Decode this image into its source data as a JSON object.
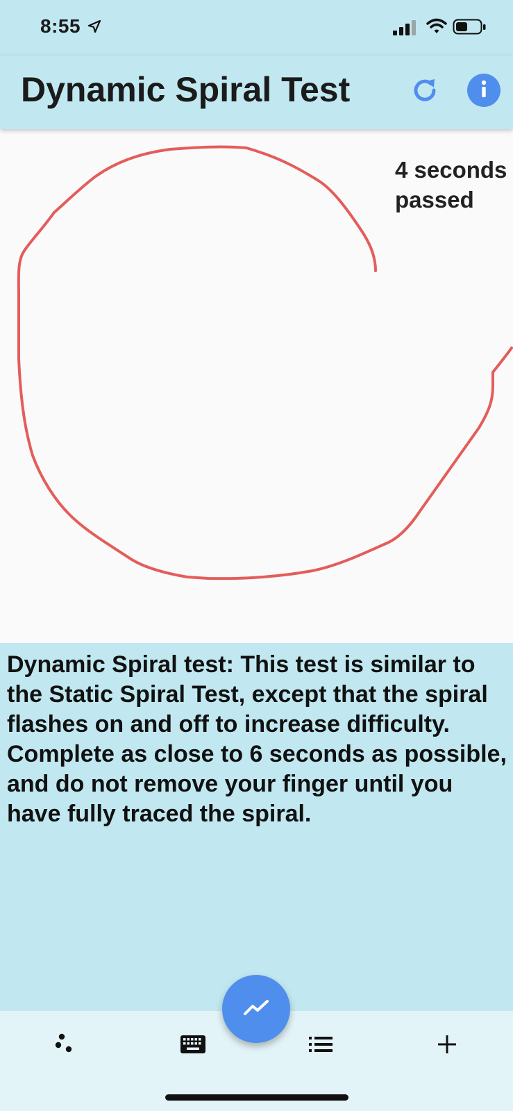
{
  "status_bar": {
    "time": "8:55"
  },
  "app_bar": {
    "title": "Dynamic Spiral Test",
    "refresh_icon": "refresh-icon",
    "info_icon": "info-icon"
  },
  "canvas": {
    "timer_text": "4 seconds passed",
    "stroke_color": "#e35d5b"
  },
  "instructions": {
    "text": "Dynamic Spiral test: This test is similar to the Static Spiral Test, except that the spiral flashes on and off to increase difficulty. Complete as close to 6 seconds as possible, and do not remove your finger until you have fully traced the spiral."
  },
  "bottom_nav": {
    "items": [
      {
        "icon": "scatter-dots-icon"
      },
      {
        "icon": "keyboard-icon"
      },
      {
        "icon": "list-icon"
      },
      {
        "icon": "plus-icon"
      }
    ],
    "fab_icon": "trending-line-icon"
  },
  "colors": {
    "header_bg": "#c1e8f0",
    "accent": "#4f8eed",
    "canvas_bg": "#fafafa",
    "bottom_bar_bg": "#e3f4f8",
    "stroke": "#e35d5b"
  }
}
